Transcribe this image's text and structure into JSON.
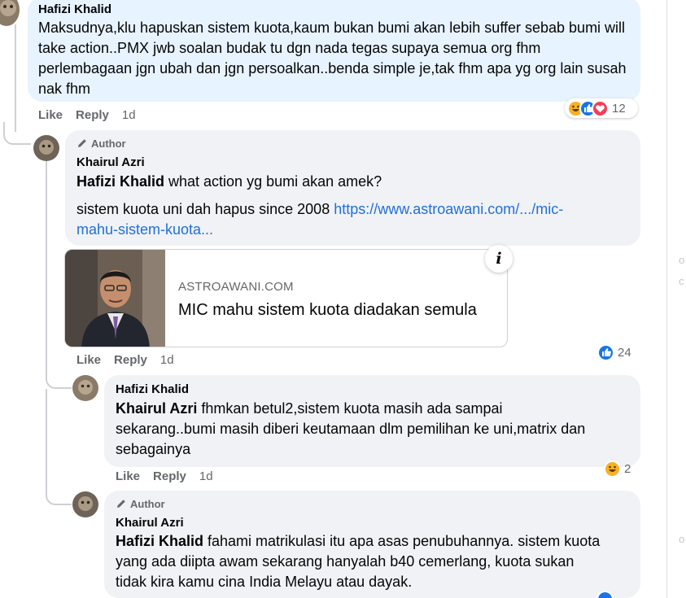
{
  "comments": [
    {
      "author": "Hafizi Khalid",
      "is_author": false,
      "text": "Maksudnya,klu hapuskan sistem kuota,kaum bukan bumi akan lebih suffer sebab bumi will take action..PMX jwb soalan budak tu dgn nada tegas supaya semua org fhm perlembagaan jgn ubah dan jgn persoalkan..benda simple je,tak fhm apa yg org lain susah nak fhm",
      "actions": {
        "like": "Like",
        "reply": "Reply",
        "time": "1d"
      },
      "reactions": {
        "icons": [
          "haha-icon",
          "like-icon",
          "love-icon"
        ],
        "count": "12"
      }
    },
    {
      "author_badge": "Author",
      "author": "Khairul Azri",
      "mention": "Hafizi Khalid",
      "text_1": " what action yg bumi akan amek?",
      "text_2": "sistem kuota uni dah hapus since 2008 ",
      "link_text_1": "https://www.astroawani.com/.../mic-",
      "link_text_2": "mahu-sistem-kuota...",
      "link_preview": {
        "domain": "ASTROAWANI.COM",
        "headline": "MIC mahu sistem kuota diadakan semula",
        "info_glyph": "i"
      },
      "actions": {
        "like": "Like",
        "reply": "Reply",
        "time": "1d"
      },
      "reactions": {
        "icons": [
          "like-icon"
        ],
        "count": "24"
      }
    },
    {
      "author": "Hafizi Khalid",
      "mention": "Khairul Azri",
      "text_1": " fhmkan betul2,sistem kuota masih ada sampai",
      "text_2": "sekarang..bumi masih diberi keutamaan dlm pemilihan ke uni,matrix dan",
      "text_3": "sebagainya",
      "actions": {
        "like": "Like",
        "reply": "Reply",
        "time": "1d"
      },
      "reactions": {
        "icons": [
          "haha-icon"
        ],
        "count": "2"
      }
    },
    {
      "author_badge": "Author",
      "author": "Khairul Azri",
      "mention": "Hafizi Khalid",
      "text_1": " fahami matrikulasi itu apa asas penubuhannya. sistem kuota",
      "text_2": "yang ada diipta awam sekarang hanyalah b40 cemerlang, kuota sukan",
      "text_3": "tidak kira kamu cina India Melayu atau dayak."
    }
  ],
  "colors": {
    "blue_bubble": "#e7f3ff",
    "gray_bubble": "#f0f2f5",
    "link": "#216fdb",
    "meta": "#65676b"
  }
}
